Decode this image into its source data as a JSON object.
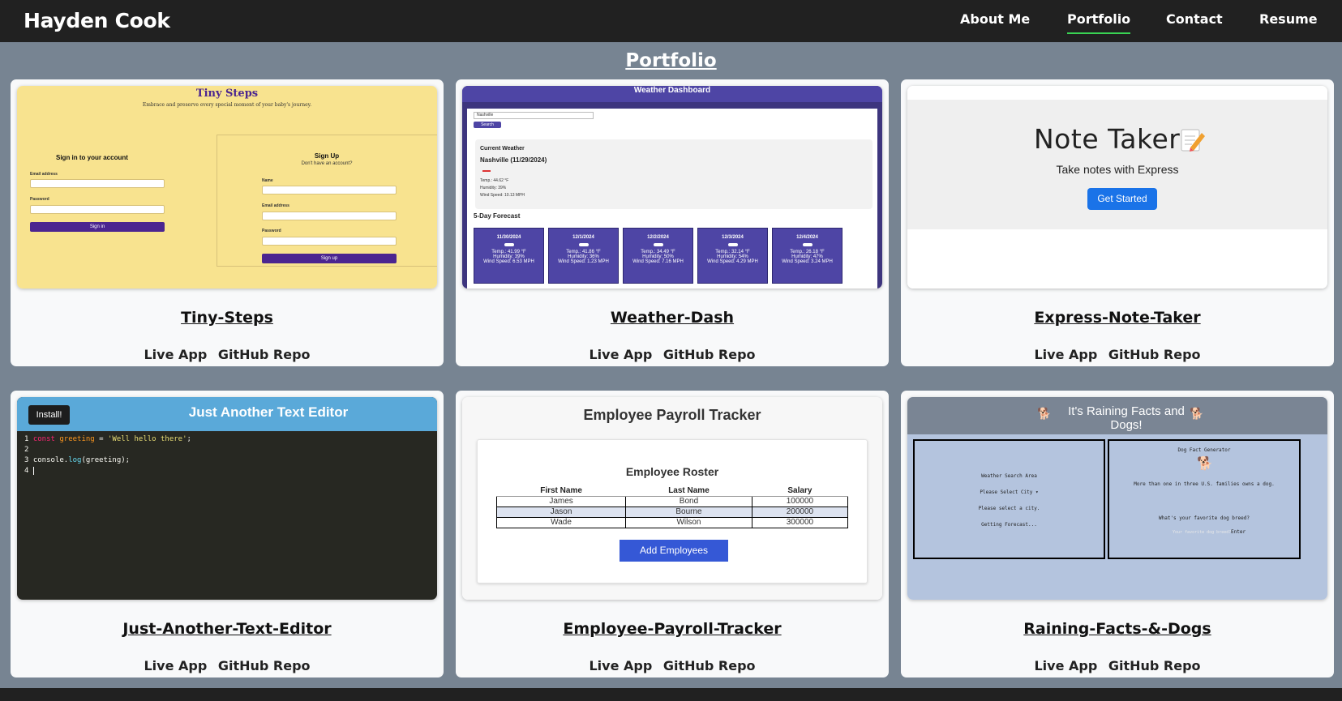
{
  "header": {
    "brand": "Hayden Cook",
    "nav": [
      {
        "label": "About Me"
      },
      {
        "label": "Portfolio",
        "active": true
      },
      {
        "label": "Contact"
      },
      {
        "label": "Resume"
      }
    ]
  },
  "page": {
    "title": "Portfolio"
  },
  "projects": [
    {
      "title": "Tiny-Steps",
      "live_label": "Live App",
      "repo_label": "GitHub Repo",
      "preview": {
        "heading": "Tiny Steps",
        "tagline": "Embrace and preserve every special moment of your baby's journey.",
        "signin_title": "Sign in to your account",
        "email_label": "Email address",
        "password_label": "Password",
        "signin_button": "Sign in",
        "signup_title": "Sign Up",
        "signup_subtitle": "Don't have an account?",
        "name_label": "Name",
        "signup_email_label": "Email address",
        "signup_password_label": "Password",
        "signup_button": "Sign up"
      }
    },
    {
      "title": "Weather-Dash",
      "live_label": "Live App",
      "repo_label": "GitHub Repo",
      "preview": {
        "heading": "Weather Dashboard",
        "search_value": "Nashville",
        "search_button": "Search",
        "current_label": "Current Weather",
        "current_city": "Nashville (11/29/2024)",
        "current_temp": "Temp.: 44.62 °F",
        "current_humidity": "Humidity: 39%",
        "current_wind": "Wind Speed: 10.13 MPH",
        "forecast_label": "5-Day Forecast",
        "forecast": [
          {
            "date": "11/30/2024",
            "temp": "Temp.: 41.99 °F",
            "humidity": "Humidity: 39%",
            "wind": "Wind Speed: 6.53 MPH"
          },
          {
            "date": "12/1/2024",
            "temp": "Temp.: 41.86 °F",
            "humidity": "Humidity: 36%",
            "wind": "Wind Speed: 1.23 MPH"
          },
          {
            "date": "12/2/2024",
            "temp": "Temp.: 34.49 °F",
            "humidity": "Humidity: 50%",
            "wind": "Wind Speed: 7.16 MPH"
          },
          {
            "date": "12/3/2024",
            "temp": "Temp.: 32.14 °F",
            "humidity": "Humidity: 54%",
            "wind": "Wind Speed: 4.29 MPH"
          },
          {
            "date": "12/4/2024",
            "temp": "Temp.: 26.18 °F",
            "humidity": "Humidity: 47%",
            "wind": "Wind Speed: 3.24 MPH"
          }
        ]
      }
    },
    {
      "title": "Express-Note-Taker",
      "live_label": "Live App",
      "repo_label": "GitHub Repo",
      "preview": {
        "heading": "Note Taker",
        "subtitle": "Take notes with Express",
        "button": "Get Started"
      }
    },
    {
      "title": "Just-Another-Text-Editor",
      "live_label": "Live App",
      "repo_label": "GitHub Repo",
      "preview": {
        "install_button": "Install!",
        "heading": "Just Another Text Editor",
        "line_numbers": [
          "1",
          "2",
          "3",
          "4"
        ],
        "code_keyword": "const",
        "code_var": "greeting",
        "code_eq": " = ",
        "code_string": "'Well hello there'",
        "code_semicolon": ";",
        "code_line3_a": "console.",
        "code_line3_fn": "log",
        "code_line3_b": "(greeting);"
      }
    },
    {
      "title": "Employee-Payroll-Tracker",
      "live_label": "Live App",
      "repo_label": "GitHub Repo",
      "preview": {
        "heading": "Employee Payroll Tracker",
        "roster_title": "Employee Roster",
        "columns": [
          "First Name",
          "Last Name",
          "Salary"
        ],
        "rows": [
          [
            "James",
            "Bond",
            "100000"
          ],
          [
            "Jason",
            "Bourne",
            "200000"
          ],
          [
            "Wade",
            "Wilson",
            "300000"
          ]
        ],
        "button": "Add Employees"
      }
    },
    {
      "title": "Raining-Facts-&-Dogs",
      "live_label": "Live App",
      "repo_label": "GitHub Repo",
      "preview": {
        "heading": "It's Raining Facts and Dogs!",
        "left_title": "Weather Search Area",
        "left_select": "Please Select City ▾",
        "left_msg1": "Please select a city.",
        "left_msg2": "Getting Forecast...",
        "right_title": "Dog Fact Generator",
        "right_fact": "More than one in three U.S. families owns a dog.",
        "right_question": "What's your favorite dog breed?",
        "right_placeholder": "Your favorite dog breed?",
        "right_button": "Enter"
      }
    }
  ],
  "colors": {
    "page_bg": "#778492",
    "header_bg": "#212121",
    "card_bg": "#f8f9fa",
    "active_underline": "#39d353"
  }
}
